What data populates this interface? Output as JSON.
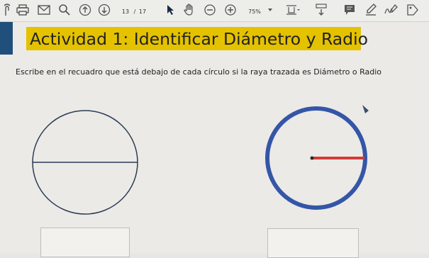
{
  "toolbar": {
    "current_page": "13",
    "page_separator": "/",
    "total_pages": "17",
    "zoom_value": "75%"
  },
  "activity": {
    "title": "Actividad 1: Identificar Diámetro y Radio",
    "instruction": "Escribe en el recuadro que está debajo de cada círculo si la raya trazada es Diámetro o Radio"
  },
  "figures": [
    {
      "line_type_shown": "diameter",
      "outline_color": "#2a3b56",
      "line_color": "#2a3b56"
    },
    {
      "line_type_shown": "radius",
      "outline_color": "#3456a8",
      "line_color": "#d43a3a"
    }
  ],
  "answer_boxes": [
    {
      "value": ""
    },
    {
      "value": ""
    }
  ],
  "colors": {
    "title_highlight": "#e4c200",
    "accent_bar": "#1f4f7a"
  }
}
